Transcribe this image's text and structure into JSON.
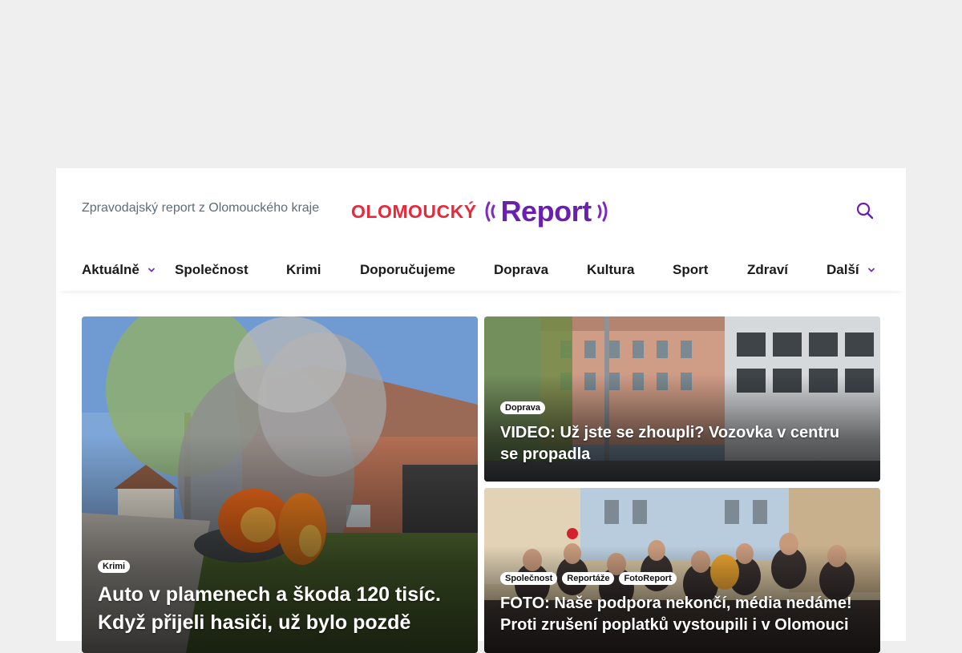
{
  "header": {
    "tagline": "Zpravodajský report z Olomouckého kraje",
    "logo": {
      "part1": "OLOMOUCKÝ",
      "part2": "Report"
    },
    "search_icon": "search-icon"
  },
  "nav": {
    "items": [
      {
        "label": "Aktuálně",
        "has_dropdown": true
      },
      {
        "label": "Společnost"
      },
      {
        "label": "Krimi"
      },
      {
        "label": "Doporučujeme"
      },
      {
        "label": "Doprava"
      },
      {
        "label": "Kultura"
      },
      {
        "label": "Sport"
      },
      {
        "label": "Zdraví"
      },
      {
        "label": "Další",
        "has_dropdown": true
      }
    ]
  },
  "articles": [
    {
      "tags": [
        "Krimi"
      ],
      "title": "Auto v plamenech a škoda 120 tisíc. Když přijeli hasiči, už bylo pozdě"
    },
    {
      "tags": [
        "Doprava"
      ],
      "title": "VIDEO: Už jste se zhoupli? Vozovka v centru se propadla"
    },
    {
      "tags": [
        "Společnost",
        "Reportáže",
        "FotoReport"
      ],
      "title": "FOTO: Naše podpora nekončí, média nedáme! Proti zrušení poplatků vystoupili i v Olomouci"
    }
  ],
  "colors": {
    "logo_red": "#e8293a",
    "logo_purple": "#6a1fb0",
    "accent": "#7b2cbf",
    "page_bg": "#efefef"
  }
}
